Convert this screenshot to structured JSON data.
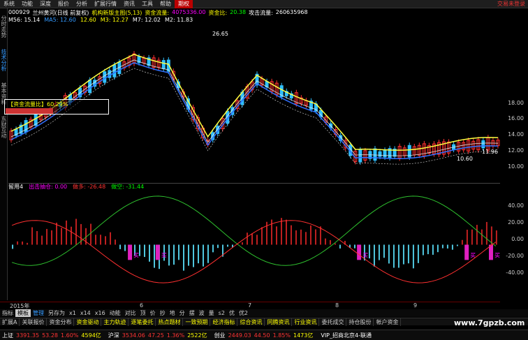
{
  "menu": [
    "系统",
    "功能",
    "深度",
    "报价",
    "分析",
    "扩展行情",
    "资讯",
    "工具",
    "帮助",
    "期权"
  ],
  "menu_right": "交易未登录",
  "sidebar": [
    "分时走势",
    "技术分析",
    "基本资料",
    "东财互动"
  ],
  "info": {
    "code": "000929",
    "name": "兰州黄河(日线 前复权)",
    "desc": "机构新版主图(5,13)",
    "flow_label": "资金流量:",
    "flow_val": "4075336.00",
    "cz_label": "资金比:",
    "cz_val": "20.38",
    "atk_label": "攻击流量:",
    "atk_val": "260635968"
  },
  "ma": {
    "m56": "M56: 15.14",
    "ma5": "MA5: 12.60",
    "m2": "12.60",
    "m3": "M3: 12.27",
    "m7": "M7: 12.02",
    "m2b": "M2: 11.83"
  },
  "boxlabel": "【资金流量比】60.29%",
  "yticks": [
    "18.00",
    "16.00",
    "14.00",
    "12.00",
    "10.00"
  ],
  "ind_yticks": [
    "40.00",
    "20.00",
    "0.00",
    "-20.00",
    "-40.00"
  ],
  "price_marks": {
    "high": "26.65",
    "low": "10.60",
    "last": "11.96"
  },
  "ind": {
    "name": "留用4",
    "l1": "出击抽仓: 0.00",
    "l2": "做多: -26.48",
    "l3": "做空: -31.44"
  },
  "xlabels": [
    "2015年",
    "6",
    "7",
    "8",
    "9"
  ],
  "buy": "买",
  "toolbar": [
    "指标",
    "模板",
    "管理",
    "另存为",
    "x1",
    "x14",
    "x16",
    "动能",
    "对比",
    "顶",
    "价",
    "抄",
    "地",
    "分",
    "摆",
    "波",
    "量",
    "s2",
    "优",
    "优2"
  ],
  "tabs": [
    "扩展A",
    "关联报价",
    "资金分布",
    "资金驱动",
    "主力轨迹",
    "逐笔委托",
    "热点题材",
    "一致预期",
    "经济指标",
    "综合资讯",
    "同腾资讯",
    "行业资讯",
    "委托成交",
    "持仓股份",
    "帐户资金"
  ],
  "status": [
    {
      "n": "上证",
      "v": "3391.35",
      "c": "53.28",
      "p": "1.60%",
      "a": "4594亿"
    },
    {
      "n": "沪深",
      "v": "3534.06",
      "c": "47.25",
      "p": "1.36%",
      "a": "2522亿"
    },
    {
      "n": "创业",
      "v": "2449.03",
      "c": "44.50",
      "p": "1.85%",
      "a": "1473亿"
    }
  ],
  "status_right": "VIP_招商北京4-联通",
  "watermark": "www.7gpzb.com",
  "colors": {
    "up": "#ff3030",
    "down": "#30c0ff",
    "ma_yellow": "#ffff40",
    "ma_blue": "#3070ff",
    "ma_white": "#e0e0e0",
    "green": "#2ec02e"
  }
}
